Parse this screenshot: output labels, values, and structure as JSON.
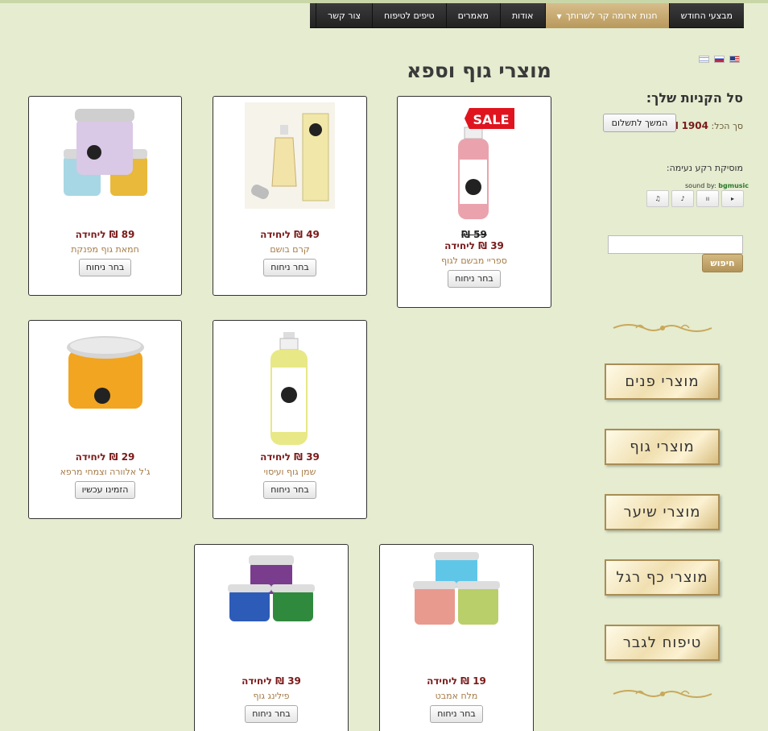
{
  "nav": {
    "items": [
      "מבצעי החודש",
      "חנות ארומה קר לשרותך",
      "אודות",
      "מאמרים",
      "טיפים לטיפוח",
      "צור קשר"
    ]
  },
  "page": {
    "title": "מוצרי גוף וספא"
  },
  "cart": {
    "title": "סל הקניות שלך:",
    "total_label": "סך הכל:",
    "total_amount": "1904 ₪",
    "checkout_label": "המשך לתשלום"
  },
  "music": {
    "label": "מוסיקת רקע נעימה:",
    "sound_by": "sound by:",
    "brand": "bgmusic",
    "controls": [
      "▸",
      "ıı",
      "♪",
      "♫"
    ]
  },
  "search": {
    "button_label": "חיפוש",
    "value": ""
  },
  "categories": [
    "מוצרי פנים",
    "מוצרי גוף",
    "מוצרי שיער",
    "מוצרי כף רגל",
    "טיפוח לגבר"
  ],
  "products": [
    {
      "name": "ספריי מבשם לגוף",
      "old_price": "59 ₪",
      "price": "39 ₪ ליחידה",
      "button": "בחר ניחוח",
      "badge": "SALE"
    },
    {
      "name": "קרם בושם",
      "price": "49 ₪ ליחידה",
      "button": "בחר ניחוח"
    },
    {
      "name": "חמאת גוף מפנקת",
      "price": "89 ₪ ליחידה",
      "button": "בחר ניחוח"
    },
    {
      "name": "שמן גוף ועיסוי",
      "price": "39 ₪ ליחידה",
      "button": "בחר ניחוח"
    },
    {
      "name": "ג'ל אלוורה וצמחי מרפא",
      "price": "29 ₪ ליחידה",
      "button": "הזמינו עכשיו"
    },
    {
      "name": "מלח אמבט",
      "price": "19 ₪ ליחידה",
      "button": "בחר ניחוח"
    },
    {
      "name": "פילינג גוף",
      "price": "39 ₪ ליחידה",
      "button": "בחר ניחוח"
    }
  ],
  "colors": {
    "nav_bg": "#2b2b2b",
    "nav_active": "#c4a76e",
    "page_bg": "#e5ecd0",
    "price": "#7a1a1a",
    "product_name": "#a57a45"
  }
}
